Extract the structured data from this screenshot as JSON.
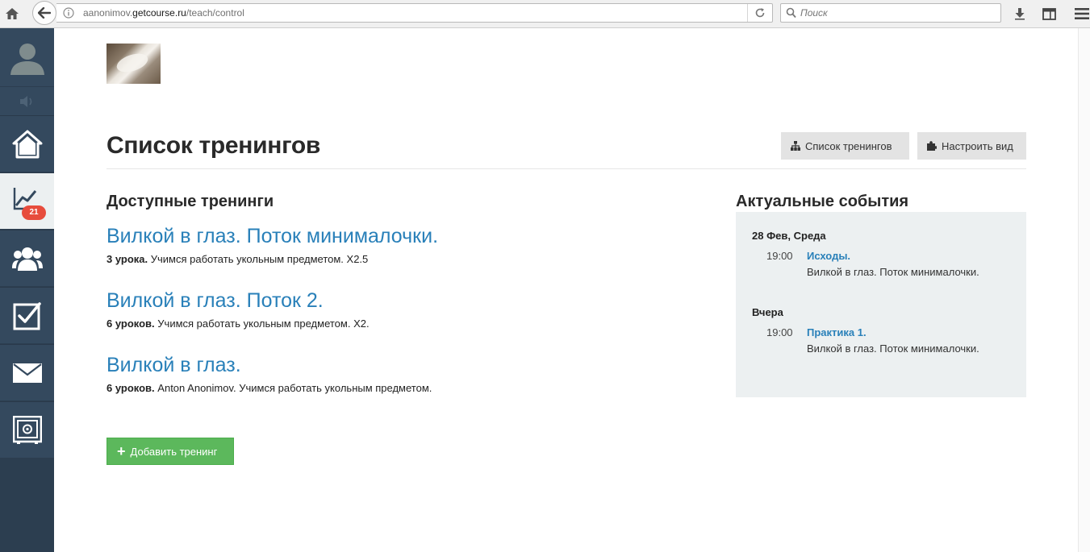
{
  "browser": {
    "url_prefix": "aanonimov.",
    "url_domain": "getcourse.ru",
    "url_path": "/teach/control",
    "search_placeholder": "Поиск"
  },
  "sidebar": {
    "badge_count": "21",
    "items": [
      {
        "icon": "home-icon"
      },
      {
        "icon": "chart-icon",
        "active": true
      },
      {
        "icon": "users-icon"
      },
      {
        "icon": "checkbox-icon"
      },
      {
        "icon": "mail-icon"
      },
      {
        "icon": "safe-icon"
      }
    ]
  },
  "header": {
    "title": "Список тренингов",
    "btn_list": "Список тренингов",
    "btn_view": "Настроить вид"
  },
  "available": {
    "heading": "Доступные тренинги",
    "trainings": [
      {
        "title": "Вилкой в глаз. Поток минималочки.",
        "count": "3 урока.",
        "desc": "Учимся работать укольным предметом. X2.5"
      },
      {
        "title": "Вилкой в глаз. Поток 2.",
        "count": "6 уроков.",
        "desc": "Учимся работать укольным предметом. X2."
      },
      {
        "title": "Вилкой в глаз.",
        "count": "6 уроков.",
        "desc": "Anton Anonimov. Учимся работать укольным предметом."
      }
    ],
    "add_button": "Добавить тренинг"
  },
  "events": {
    "heading": "Актуальные события",
    "groups": [
      {
        "date": "28 Фев, Среда",
        "time": "19:00",
        "title": "Исходы.",
        "desc": "Вилкой в глаз. Поток минималочки."
      },
      {
        "date": "Вчера",
        "time": "19:00",
        "title": "Практика 1.",
        "desc": "Вилкой в глаз. Поток минималочки."
      }
    ]
  },
  "colors": {
    "sidebar_bg": "#34495e",
    "link": "#2980b9",
    "add_button": "#5cb85c",
    "badge": "#e74c3c",
    "events_bg": "#ecf0f1"
  }
}
